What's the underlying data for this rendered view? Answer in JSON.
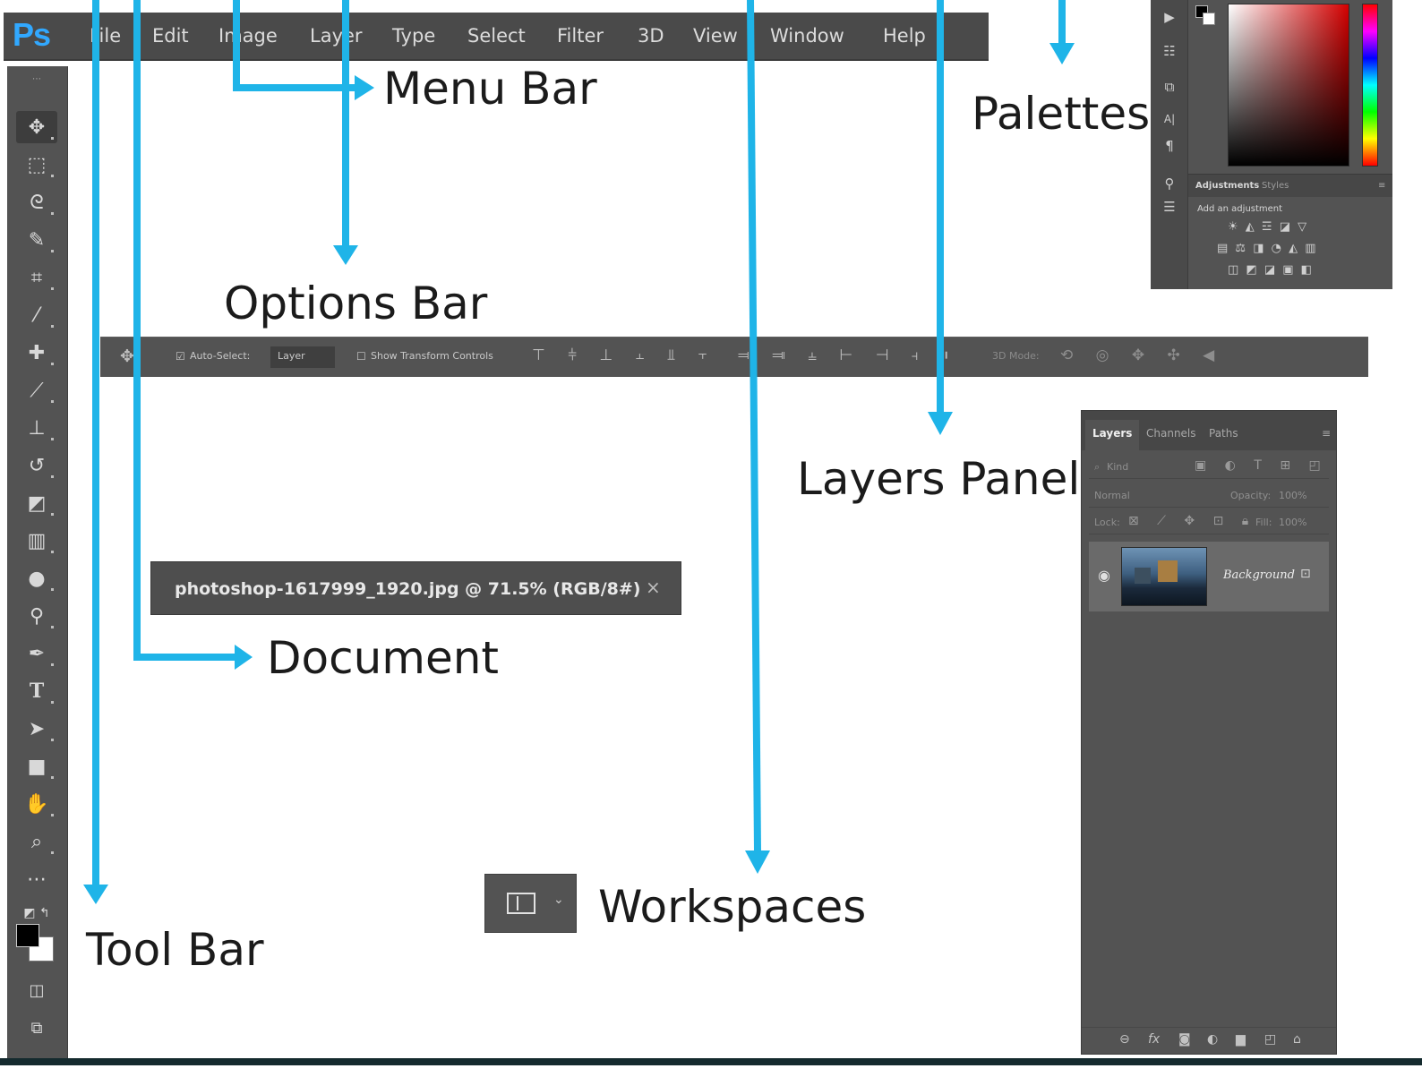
{
  "menubar": {
    "logo": "Ps",
    "items": [
      "File",
      "Edit",
      "Image",
      "Layer",
      "Type",
      "Select",
      "Filter",
      "3D",
      "View",
      "Window",
      "Help"
    ]
  },
  "options_bar": {
    "auto_select_label": "Auto-Select:",
    "auto_select_value": "Layer",
    "transform_label": "Show Transform Controls",
    "mode_label": "3D Mode:"
  },
  "document": {
    "tab_title": "photoshop-1617999_1920.jpg @ 71.5% (RGB/8#)",
    "close_glyph": "×"
  },
  "palettes": {
    "tabs": [
      "Adjustments",
      "Styles"
    ],
    "subtitle": "Add an adjustment"
  },
  "layers_panel": {
    "tabs": [
      "Layers",
      "Channels",
      "Paths"
    ],
    "filter_placeholder": "Kind",
    "blend_mode": "Normal",
    "opacity_label": "Opacity:",
    "opacity_value": "100%",
    "lock_label": "Lock:",
    "fill_label": "Fill:",
    "fill_value": "100%",
    "layer_name": "Background"
  },
  "callouts": {
    "menu_bar": "Menu Bar",
    "palettes": "Palettes",
    "options_bar": "Options Bar",
    "layers_panel": "Layers Panel",
    "document": "Document",
    "workspaces": "Workspaces",
    "tool_bar": "Tool Bar"
  },
  "colors": {
    "arrow": "#1fb4e8",
    "panel": "#535353",
    "ps_brand": "#31a8ff",
    "label": "#1b1b1b"
  },
  "icons": {
    "tools": [
      "move-icon",
      "marquee-icon",
      "lasso-icon",
      "quick-select-icon",
      "crop-icon",
      "eyedropper-icon",
      "healing-brush-icon",
      "brush-icon",
      "clone-stamp-icon",
      "history-brush-icon",
      "eraser-icon",
      "gradient-icon",
      "blur-icon",
      "dodge-icon",
      "pen-icon",
      "type-icon",
      "path-select-icon",
      "rectangle-icon",
      "hand-icon",
      "zoom-icon",
      "more-tools-icon"
    ]
  }
}
